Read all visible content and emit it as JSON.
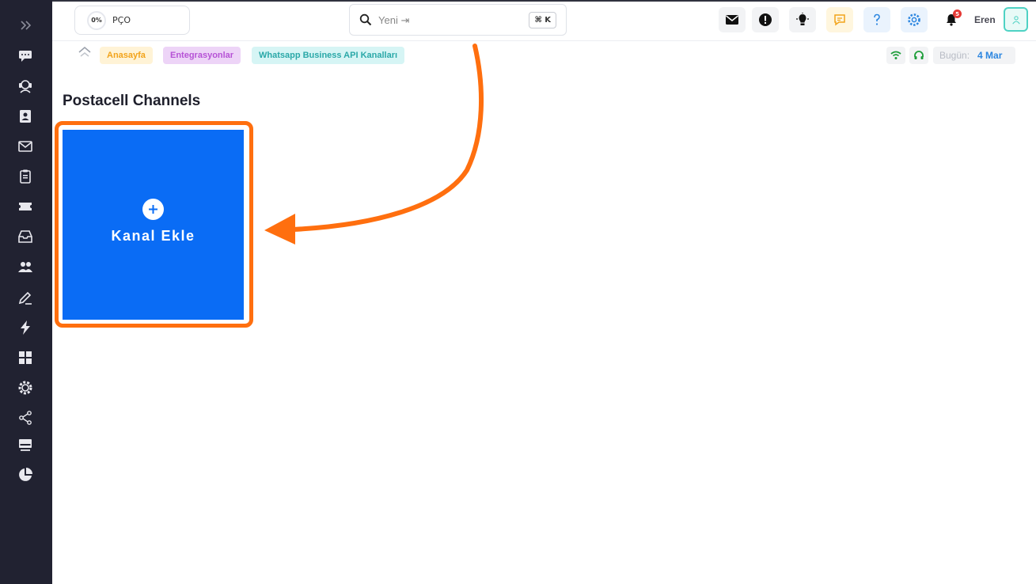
{
  "header": {
    "progress": {
      "percent_text": "0%",
      "label": "PÇO"
    },
    "search": {
      "placeholder": "Yeni ⇥",
      "shortcut": "⌘ K"
    },
    "notifications": {
      "count": "5"
    },
    "user": {
      "name": "Eren"
    }
  },
  "sidebar": {
    "items": [
      {
        "icon": "expand-icon"
      },
      {
        "icon": "chat-icon"
      },
      {
        "icon": "customer-support-icon"
      },
      {
        "icon": "contacts-icon"
      },
      {
        "icon": "mail-icon"
      },
      {
        "icon": "clipboard-icon"
      },
      {
        "icon": "ticket-icon"
      },
      {
        "icon": "inbox-icon"
      },
      {
        "icon": "users-icon"
      },
      {
        "icon": "edit-icon"
      },
      {
        "icon": "lightning-icon"
      },
      {
        "icon": "grid-icon"
      },
      {
        "icon": "settings-icon"
      },
      {
        "icon": "share-icon"
      },
      {
        "icon": "monitor-icon"
      },
      {
        "icon": "pie-chart-icon"
      }
    ]
  },
  "breadcrumb": {
    "items": [
      {
        "label": "Anasayfa"
      },
      {
        "label": "Entegrasyonlar"
      },
      {
        "label": "Whatsapp Business API Kanalları"
      }
    ]
  },
  "status": {
    "date_label": "Bugün:",
    "date_value": "4 Mar"
  },
  "main": {
    "title": "Postacell Channels",
    "add_card": {
      "label": "Kanal Ekle"
    }
  },
  "colors": {
    "sidebar_bg": "#212231",
    "card_blue": "#0a6cf5",
    "highlight_orange": "#ff6f0f"
  }
}
